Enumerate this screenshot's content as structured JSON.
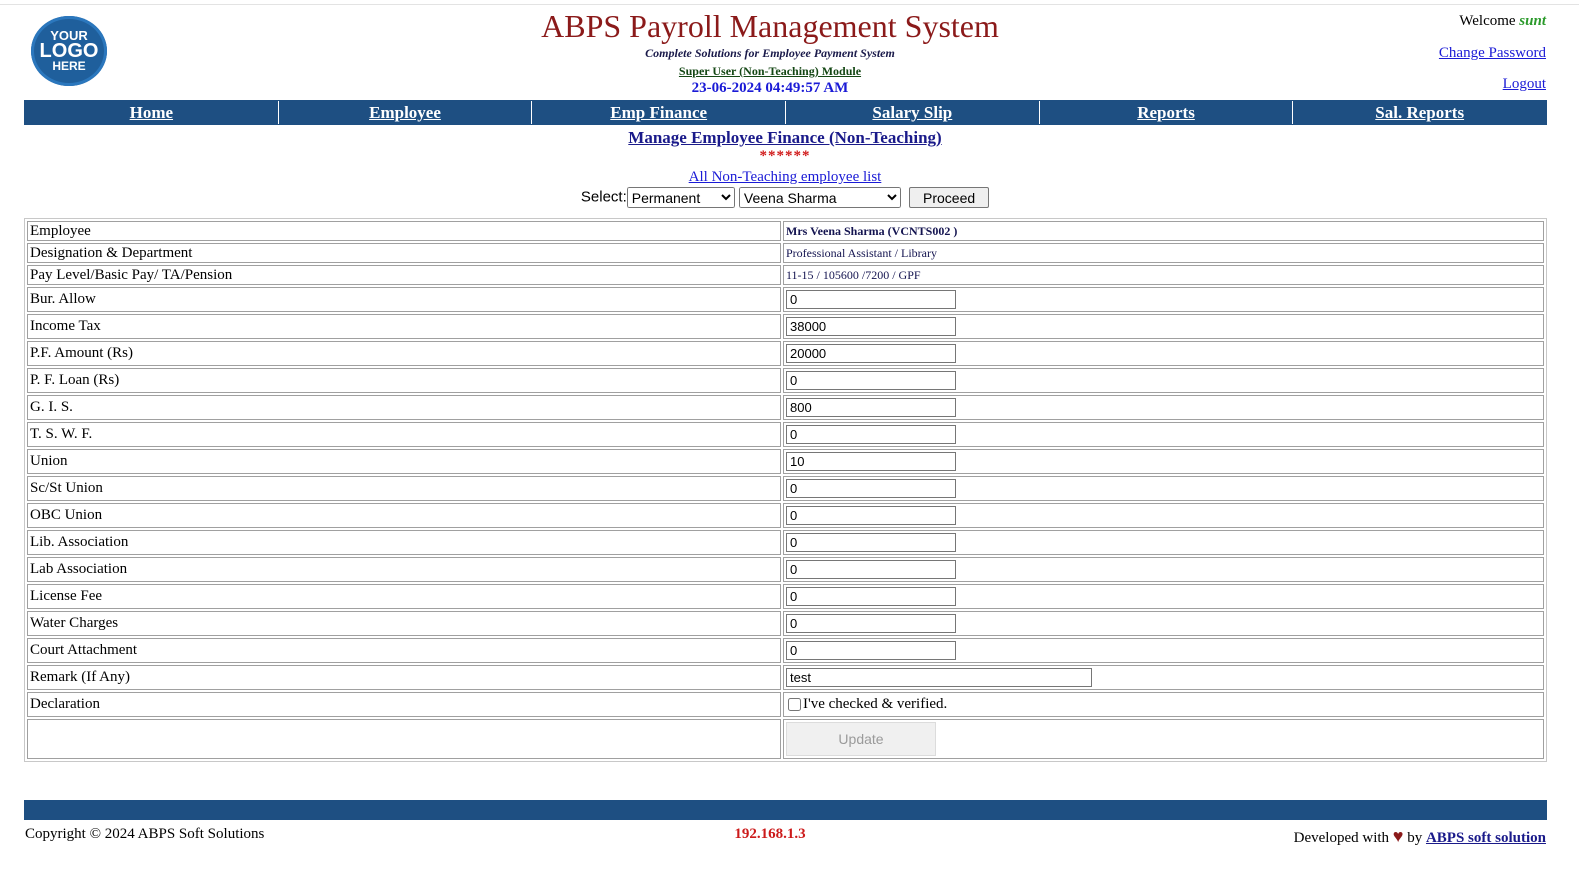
{
  "logo": {
    "line1": "YOUR",
    "line2": "LOGO",
    "line3": "HERE"
  },
  "header": {
    "title": "ABPS Payroll Management System",
    "tagline": "Complete Solutions for Employee Payment System",
    "module": "Super User (Non-Teaching) Module",
    "datetime": "23-06-2024 04:49:57 AM",
    "welcome_label": "Welcome",
    "username": "sunt",
    "change_password": "Change Password",
    "logout": "Logout"
  },
  "nav": [
    "Home",
    "Employee",
    "Emp Finance",
    "Salary Slip",
    "Reports",
    "Sal. Reports"
  ],
  "page": {
    "heading": "Manage Employee Finance (Non-Teaching)",
    "stars": "******",
    "all_list_link": "All Non-Teaching employee list",
    "select_label": "Select:",
    "type_selected": "Permanent",
    "employee_selected": "Veena Sharma",
    "proceed": "Proceed"
  },
  "info": {
    "employee_label": "Employee",
    "employee_value": "Mrs Veena Sharma  (VCNTS002 )",
    "designation_label": "Designation & Department",
    "designation_value": "Professional Assistant / Library",
    "pay_label": "Pay Level/Basic Pay/ TA/Pension",
    "pay_value": "11-15 / 105600  /7200 / GPF"
  },
  "fields": [
    {
      "label": "Bur. Allow",
      "value": "0"
    },
    {
      "label": "Income Tax",
      "value": "38000"
    },
    {
      "label": "P.F. Amount (Rs)",
      "value": "20000"
    },
    {
      "label": "P. F. Loan (Rs)",
      "value": "0"
    },
    {
      "label": "G. I. S.",
      "value": "800"
    },
    {
      "label": "T. S. W. F.",
      "value": "0"
    },
    {
      "label": "Union",
      "value": "10"
    },
    {
      "label": "Sc/St Union",
      "value": "0"
    },
    {
      "label": "OBC Union",
      "value": "0"
    },
    {
      "label": "Lib. Association",
      "value": "0"
    },
    {
      "label": "Lab Association",
      "value": "0"
    },
    {
      "label": "License Fee",
      "value": "0"
    },
    {
      "label": "Water Charges",
      "value": "0"
    },
    {
      "label": "Court Attachment",
      "value": "0"
    }
  ],
  "remark": {
    "label": "Remark (If Any)",
    "value": "test"
  },
  "declaration": {
    "label": "Declaration",
    "text": "I've checked & verified."
  },
  "update_label": "Update",
  "footer": {
    "copyright": "Copyright © 2024 ABPS Soft Solutions",
    "ip": "192.168.1.3",
    "developed_with": "Developed with",
    "by": "by",
    "company": "ABPS soft solution"
  },
  "colors": {
    "nav_bg": "#1e4f82",
    "title": "#8b1a1a",
    "link": "#1a1ad6",
    "alert": "#d01818"
  }
}
